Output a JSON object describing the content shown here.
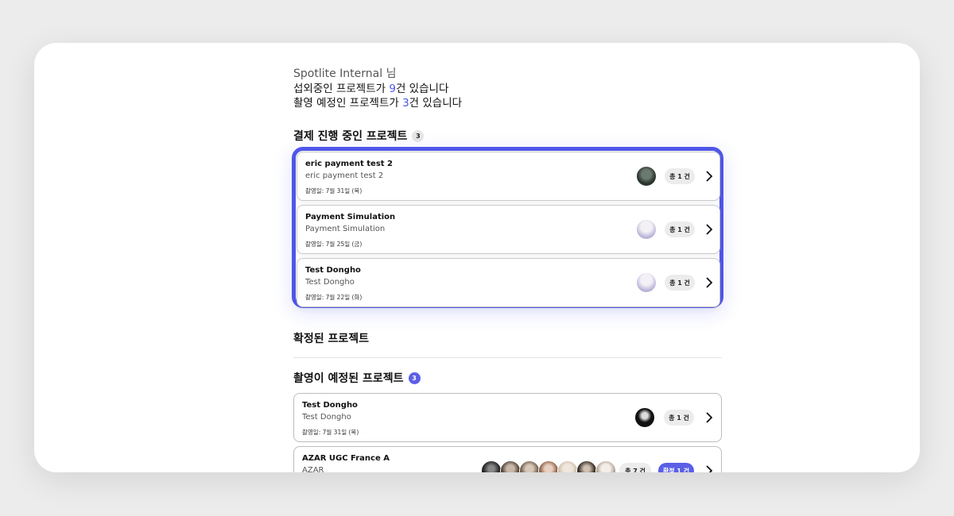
{
  "greeting": {
    "name_line": "Spotlite Internal 님",
    "line1_prefix": "섭외중인 프로젝트가 ",
    "line1_count": "9",
    "line1_suffix": "건 있습니다",
    "line2_prefix": "촬영 예정인 프로젝트가 ",
    "line2_count": "3",
    "line2_suffix": "건 있습니다"
  },
  "payment_section": {
    "title": "결제 진행 중인 프로젝트",
    "count": "3",
    "projects": [
      {
        "title": "eric payment test 2",
        "subtitle": "eric payment test 2",
        "date": "촬영일: 7월 31일 (목)",
        "total": "총 1 건",
        "avatar": "avatar-icon"
      },
      {
        "title": "Payment Simulation",
        "subtitle": "Payment Simulation",
        "date": "촬영일: 7월 25일 (금)",
        "total": "총 1 건",
        "avatar": "avatar-icon"
      },
      {
        "title": "Test Dongho",
        "subtitle": "Test Dongho",
        "date": "촬영일: 7월 22일 (화)",
        "total": "총 1 건",
        "avatar": "avatar-icon"
      }
    ]
  },
  "confirmed_section": {
    "title": "확정된 프로젝트"
  },
  "scheduled_section": {
    "title": "촬영이 예정된 프로젝트",
    "count": "3",
    "projects": [
      {
        "title": "Test Dongho",
        "subtitle": "Test Dongho",
        "date": "촬영일: 7월 31일 (목)",
        "total": "총 1 건"
      },
      {
        "title": "AZAR UGC France A",
        "subtitle": "AZAR",
        "total": "총 7 건",
        "confirmed": "확정 1 건"
      }
    ]
  },
  "colors": {
    "accent": "#5057ea",
    "count_highlight": "#4a55e8"
  },
  "icons": {
    "chevron": "chevron-right-icon"
  }
}
